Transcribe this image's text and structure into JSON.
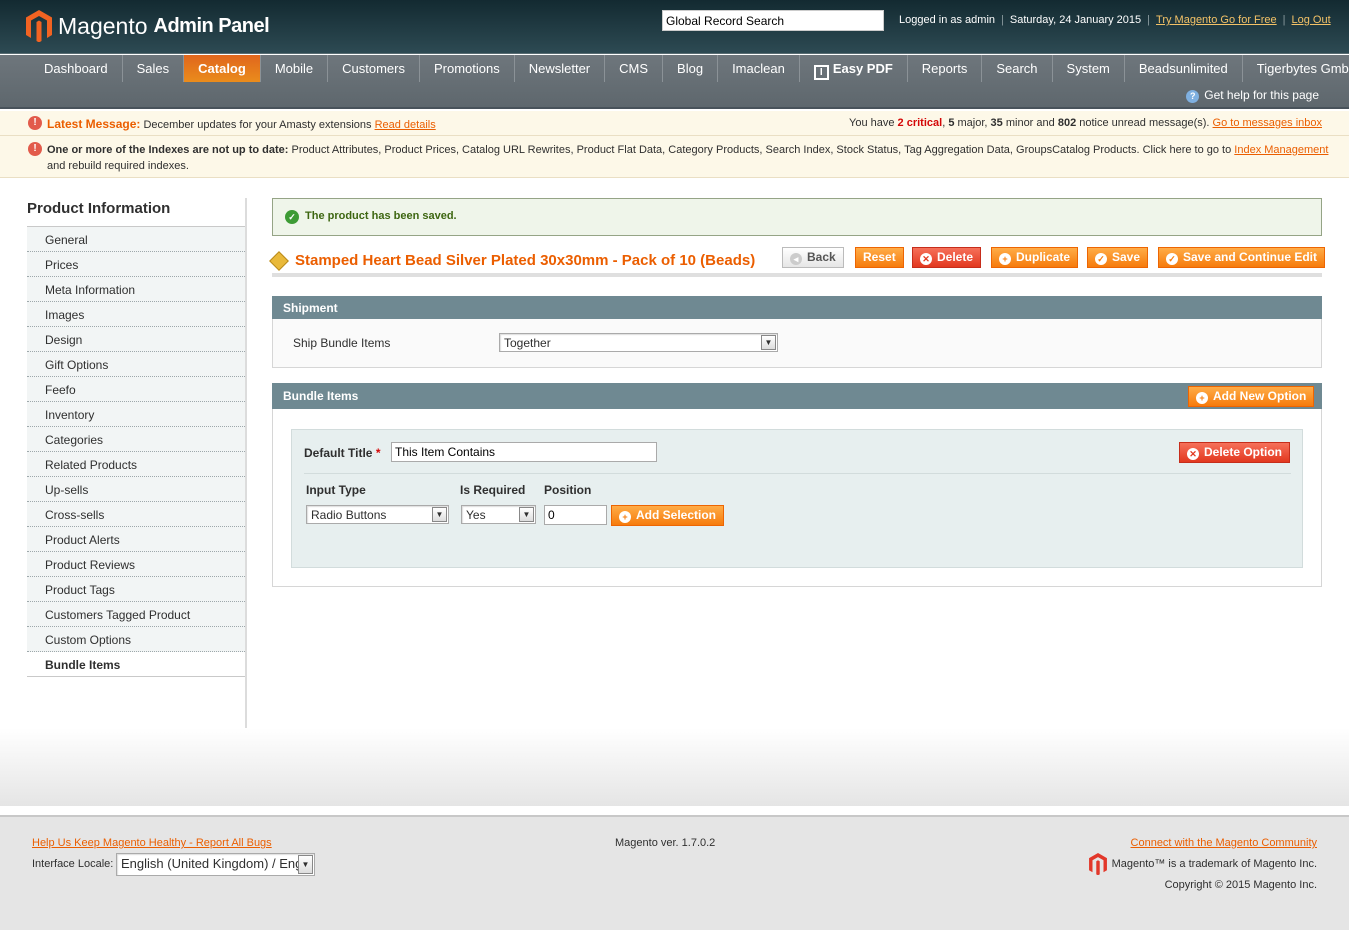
{
  "header": {
    "logo_word": "Magento",
    "logo_sub": "Admin Panel",
    "search_value": "Global Record Search",
    "logged_in": "Logged in as admin",
    "date": "Saturday, 24 January 2015",
    "try_link": "Try Magento Go for Free",
    "logout": "Log Out"
  },
  "nav": {
    "items": [
      "Dashboard",
      "Sales",
      "Catalog",
      "Mobile",
      "Customers",
      "Promotions",
      "Newsletter",
      "CMS",
      "Blog",
      "Imaclean",
      "Easy PDF",
      "Reports",
      "Search",
      "System",
      "Beadsunlimited",
      "Tigerbytes GmbH"
    ],
    "active": "Catalog",
    "help": "Get help for this page"
  },
  "messages": {
    "latest_label": "Latest Message:",
    "latest_text": "December updates for your Amasty extensions",
    "read_details": "Read details",
    "summary": {
      "pre": "You have",
      "critical": "2 critical",
      "major": "5",
      "major_lbl": "major,",
      "minor": "35",
      "minor_lbl": "minor and",
      "notice": "802",
      "notice_lbl": "notice unread message(s).",
      "inbox": "Go to messages inbox"
    },
    "index_label": "One or more of the Indexes are not up to date:",
    "index_text": "Product Attributes, Product Prices, Catalog URL Rewrites, Product Flat Data, Category Products, Search Index, Stock Status, Tag Aggregation Data, GroupsCatalog Products. Click here to go to",
    "index_link": "Index Management",
    "index_tail": "and rebuild required indexes."
  },
  "sidebar": {
    "title": "Product Information",
    "items": [
      "General",
      "Prices",
      "Meta Information",
      "Images",
      "Design",
      "Gift Options",
      "Feefo",
      "Inventory",
      "Categories",
      "Related Products",
      "Up-sells",
      "Cross-sells",
      "Product Alerts",
      "Product Reviews",
      "Product Tags",
      "Customers Tagged Product",
      "Custom Options",
      "Bundle Items"
    ],
    "active": "Bundle Items"
  },
  "main": {
    "saved": "The product has been saved.",
    "title": "Stamped Heart Bead Silver Plated 30x30mm - Pack of 10 (Beads)",
    "buttons": {
      "back": "Back",
      "reset": "Reset",
      "delete": "Delete",
      "duplicate": "Duplicate",
      "save": "Save",
      "save_continue": "Save and Continue Edit"
    },
    "shipment": {
      "title": "Shipment",
      "label": "Ship Bundle Items",
      "value": "Together"
    },
    "bundle": {
      "title": "Bundle Items",
      "add_option": "Add New Option",
      "default_title_label": "Default Title",
      "required_mark": "*",
      "default_title_value": "This Item Contains",
      "delete_option": "Delete Option",
      "input_type_label": "Input Type",
      "input_type_value": "Radio Buttons",
      "is_required_label": "Is Required",
      "is_required_value": "Yes",
      "position_label": "Position",
      "position_value": "0",
      "add_selection": "Add Selection"
    }
  },
  "footer": {
    "report_bugs": "Help Us Keep Magento Healthy - Report All Bugs",
    "version": "Magento ver. 1.7.0.2",
    "community": "Connect with the Magento Community",
    "locale_label": "Interface Locale:",
    "locale_value": "English (United Kingdom) / Engl",
    "trademark": "Magento™ is a trademark of Magento Inc.",
    "copyright": "Copyright © 2015 Magento Inc."
  },
  "colors": {
    "accent": "#eb5e00",
    "header": "#1f3d46",
    "nav": "#666e74",
    "section": "#6f8992"
  }
}
